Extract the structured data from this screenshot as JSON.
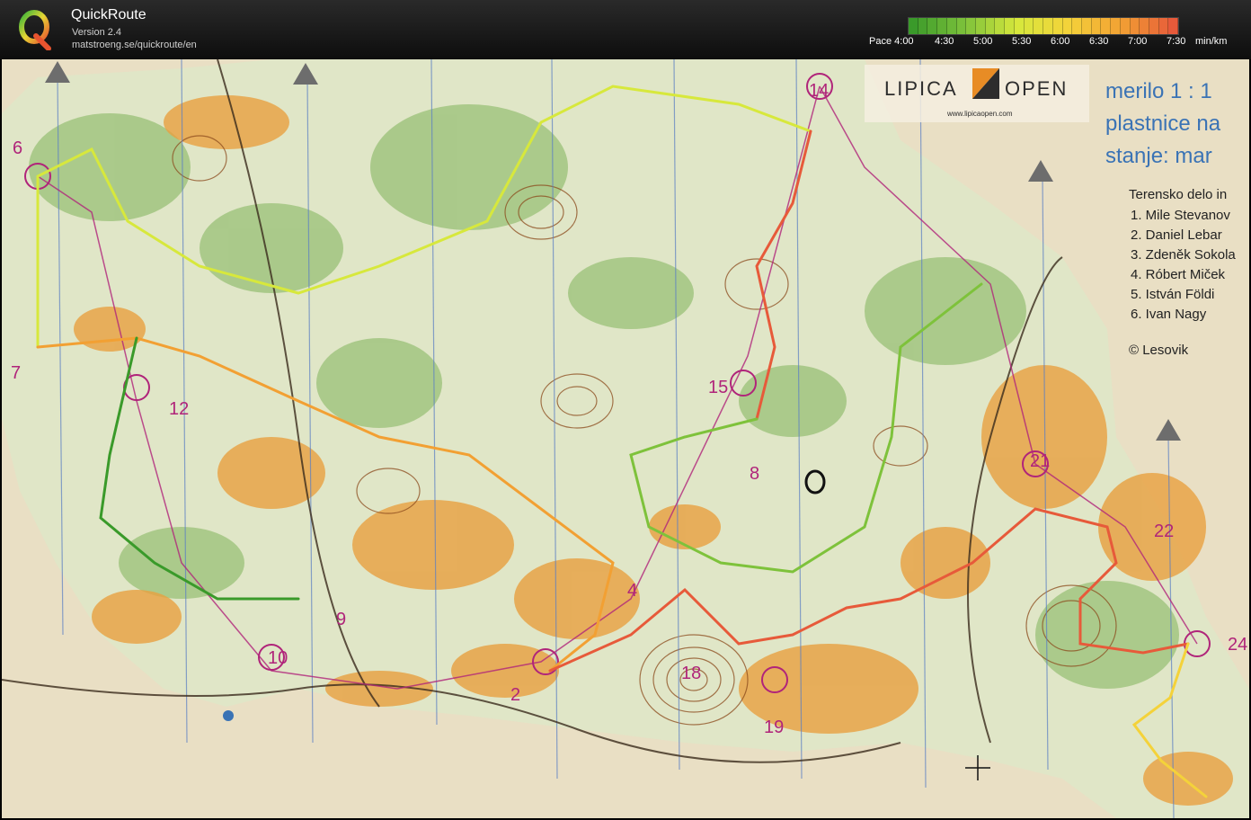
{
  "app": {
    "name": "QuickRoute",
    "version": "Version 2.4",
    "url": "matstroeng.se/quickroute/en"
  },
  "pace_scale": {
    "prefix": "Pace",
    "labels": [
      "4:00",
      "4:30",
      "5:00",
      "5:30",
      "6:00",
      "6:30",
      "7:00",
      "7:30"
    ],
    "unit": "min/km",
    "colors": [
      "#3a9a2a",
      "#7ec23b",
      "#d7e83c",
      "#f4d23a",
      "#f2a033",
      "#e75a3a"
    ]
  },
  "map": {
    "logo": {
      "first": "LIPICA",
      "second": "OPEN",
      "url": "www.lipicaopen.com"
    },
    "info_lines": [
      "merilo 1 : 1",
      "plastnice na",
      "stanje: mar"
    ],
    "credits_title": "Terensko delo in",
    "credits": [
      "1. Mile Stevanov",
      "2. Daniel Lebar",
      "3. Zdeněk Sokola",
      "4. Róbert Miček",
      "5. István Földi",
      "6. Ivan Nagy"
    ],
    "copyright": "© Lesovik",
    "control_numbers": [
      "6",
      "12",
      "14",
      "15",
      "18",
      "19",
      "21",
      "22",
      "24",
      "10",
      "2",
      "4",
      "7",
      "8",
      "9"
    ],
    "colors": {
      "paper": "#e9dfc4",
      "open_land": "#e8a040",
      "forest": "#7fb35a",
      "course": "#b0247a",
      "contour": "#8b4a1c",
      "blue_text": "#3a73b5"
    }
  }
}
